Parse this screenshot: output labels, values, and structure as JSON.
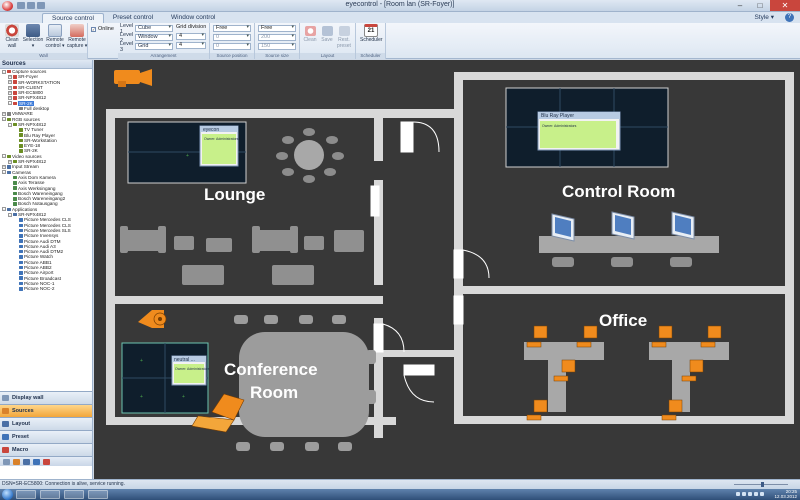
{
  "window": {
    "title": "eyecontrol - [Room lan (SR-Foyer)]",
    "buttons": [
      "–",
      "□",
      "✕"
    ]
  },
  "ribbon_tabs": [
    {
      "label": "Source control",
      "active": true
    },
    {
      "label": "Preset control",
      "active": false
    },
    {
      "label": "Window control",
      "active": false
    }
  ],
  "ribbon_right": {
    "style_label": "Style ▾",
    "help_label": "?"
  },
  "ribbon": {
    "wall": {
      "group_label": "Wall",
      "buttons": [
        {
          "label": "Clean wall"
        },
        {
          "label": "Selection ▾"
        },
        {
          "label": "Remote control ▾"
        },
        {
          "label": "Remote capture ▾"
        }
      ]
    },
    "online_label": "Online",
    "arrangement": {
      "group_label": "Arrangement",
      "levels": [
        {
          "label": "Level 1",
          "value": "Cube"
        },
        {
          "label": "Level 2",
          "value": "Window"
        },
        {
          "label": "Level 3",
          "value": "Grid"
        }
      ],
      "grid_division_label": "Grid division",
      "grid_values": [
        "4",
        "4"
      ]
    },
    "source_position": {
      "group_label": "Source position",
      "mode": "Free",
      "values": [
        "0",
        "0"
      ]
    },
    "source_size": {
      "group_label": "Source size",
      "mode": "Free",
      "values": [
        "200",
        "150"
      ]
    },
    "layout": {
      "group_label": "Layout",
      "buttons": [
        {
          "label": "Clean"
        },
        {
          "label": "Save"
        },
        {
          "label": "Rest. preset"
        }
      ]
    },
    "scheduler": {
      "group_label": "Scheduler",
      "label": "Scheduler",
      "day": "21"
    }
  },
  "sidebar": {
    "title": "Sources",
    "tree": [
      {
        "depth": 0,
        "toggle": "-",
        "label": "Capture sources",
        "color": "#c9463d"
      },
      {
        "depth": 1,
        "toggle": "+",
        "label": "SR-Foyer",
        "color": "#c9463d"
      },
      {
        "depth": 1,
        "toggle": "+",
        "label": "SR-WORKSTATION",
        "color": "#c9463d"
      },
      {
        "depth": 1,
        "toggle": "+",
        "label": "SR-CLIENT",
        "color": "#c9463d"
      },
      {
        "depth": 1,
        "toggle": "+",
        "label": "SR-EC5800",
        "color": "#c9463d"
      },
      {
        "depth": 1,
        "toggle": "+",
        "label": "SR-NPX4812",
        "color": "#c9463d"
      },
      {
        "depth": 1,
        "toggle": "-",
        "label": "SR-2K",
        "color": "#c9463d",
        "selected": true
      },
      {
        "depth": 2,
        "toggle": "",
        "label": "Full desktop",
        "color": "#7f7f7f"
      },
      {
        "depth": 0,
        "toggle": "+",
        "label": "VMWARE",
        "color": "#7f7f7f"
      },
      {
        "depth": 0,
        "toggle": "-",
        "label": "RGB sources",
        "color": "#6b8e23"
      },
      {
        "depth": 1,
        "toggle": "-",
        "label": "SR-NPX4812",
        "color": "#6b8e23"
      },
      {
        "depth": 2,
        "toggle": "",
        "label": "TV Tuner",
        "color": "#6b8e23"
      },
      {
        "depth": 2,
        "toggle": "",
        "label": "Blu Ray Player",
        "color": "#6b8e23"
      },
      {
        "depth": 2,
        "toggle": "",
        "label": "SR-Workstation",
        "color": "#6b8e23"
      },
      {
        "depth": 2,
        "toggle": "",
        "label": "EYE-18",
        "color": "#6b8e23"
      },
      {
        "depth": 2,
        "toggle": "",
        "label": "SR-2K",
        "color": "#6b8e23"
      },
      {
        "depth": 0,
        "toggle": "-",
        "label": "Video sources",
        "color": "#6b8e23"
      },
      {
        "depth": 1,
        "toggle": "+",
        "label": "SR-NPX4812",
        "color": "#6b8e23"
      },
      {
        "depth": 0,
        "toggle": "+",
        "label": "Input Stream",
        "color": "#4a6fa5"
      },
      {
        "depth": 0,
        "toggle": "-",
        "label": "Cameras",
        "color": "#4a6fa5"
      },
      {
        "depth": 1,
        "toggle": "",
        "label": "Axis Dom Kamera",
        "color": "#4a8a4a"
      },
      {
        "depth": 1,
        "toggle": "",
        "label": "Axis Terasse",
        "color": "#4a8a4a"
      },
      {
        "depth": 1,
        "toggle": "",
        "label": "Axis Werksingang",
        "color": "#4a8a4a"
      },
      {
        "depth": 1,
        "toggle": "",
        "label": "Bosch Wareneingang",
        "color": "#4a8a4a"
      },
      {
        "depth": 1,
        "toggle": "",
        "label": "Bosch Wareneingang2",
        "color": "#4a8a4a"
      },
      {
        "depth": 1,
        "toggle": "",
        "label": "Bosch Notausgang",
        "color": "#4a8a4a"
      },
      {
        "depth": 0,
        "toggle": "-",
        "label": "Applications",
        "color": "#4a6fa5"
      },
      {
        "depth": 1,
        "toggle": "-",
        "label": "SR-NPX4812",
        "color": "#4a6fa5"
      },
      {
        "depth": 2,
        "toggle": "",
        "label": "Picture Mercedes CLS",
        "color": "#3f73b8"
      },
      {
        "depth": 2,
        "toggle": "",
        "label": "Picture Mercedes CLS",
        "color": "#3f73b8"
      },
      {
        "depth": 2,
        "toggle": "",
        "label": "Picture Mercedes SLS",
        "color": "#3f73b8"
      },
      {
        "depth": 2,
        "toggle": "",
        "label": "Picture Invensys",
        "color": "#3f73b8"
      },
      {
        "depth": 2,
        "toggle": "",
        "label": "Picture Audi DTM",
        "color": "#3f73b8"
      },
      {
        "depth": 2,
        "toggle": "",
        "label": "Picture Audi A3",
        "color": "#3f73b8"
      },
      {
        "depth": 2,
        "toggle": "",
        "label": "Picture Audi DTM2",
        "color": "#3f73b8"
      },
      {
        "depth": 2,
        "toggle": "",
        "label": "Picture Watch",
        "color": "#3f73b8"
      },
      {
        "depth": 2,
        "toggle": "",
        "label": "Picture ABB1",
        "color": "#3f73b8"
      },
      {
        "depth": 2,
        "toggle": "",
        "label": "Picture ABB2",
        "color": "#3f73b8"
      },
      {
        "depth": 2,
        "toggle": "",
        "label": "Picture Airport",
        "color": "#3f73b8"
      },
      {
        "depth": 2,
        "toggle": "",
        "label": "Picture Broadcast",
        "color": "#3f73b8"
      },
      {
        "depth": 2,
        "toggle": "",
        "label": "Picture NOC-1",
        "color": "#3f73b8"
      },
      {
        "depth": 2,
        "toggle": "",
        "label": "Picture NOC-2",
        "color": "#3f73b8"
      }
    ],
    "nav": [
      {
        "label": "Display wall",
        "active": false,
        "color": "#7f97b7"
      },
      {
        "label": "Sources",
        "active": true,
        "color": "#d9822b"
      },
      {
        "label": "Layout",
        "active": false,
        "color": "#4a6fa5"
      },
      {
        "label": "Preset",
        "active": false,
        "color": "#3f73b8"
      },
      {
        "label": "Macro",
        "active": false,
        "color": "#c9463d"
      }
    ]
  },
  "floorplan": {
    "rooms": [
      {
        "name": "Lounge"
      },
      {
        "name": "Control Room"
      },
      {
        "name": "Office"
      },
      {
        "name": "Conference"
      },
      {
        "name": "Room"
      }
    ],
    "windows": {
      "lounge_popup": {
        "title": "eyecon",
        "body": "Owner: Administrators"
      },
      "control_popup": {
        "title": "Blu Ray Player",
        "body": "Owner: Administrators"
      },
      "conference_popup": {
        "title": "neutral ...",
        "body": "Owner: Administrators"
      }
    }
  },
  "statusbar": {
    "text": "DSN=SR-EC5800: Connection is alive, service running."
  },
  "taskbar": {
    "time": "20:25",
    "date": "12.03.2012"
  }
}
